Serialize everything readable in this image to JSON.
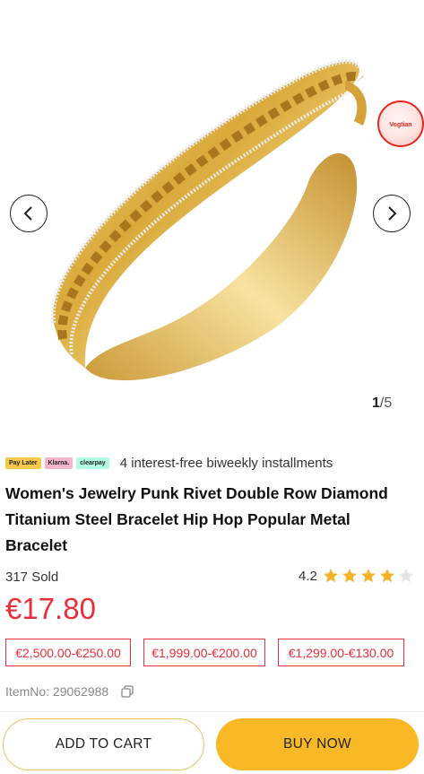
{
  "gallery": {
    "image_alt": "Gold bracelet with rivets and diamond rows",
    "current_index": "1",
    "total": "/5",
    "prev_icon": "chevron-left-icon",
    "next_icon": "chevron-right-icon",
    "promo_badge_text": "Vogtian"
  },
  "payment": {
    "logos": [
      "Pay Later",
      "Klarna.",
      "clearpay"
    ],
    "installments_text": "4 interest-free biweekly installments"
  },
  "product": {
    "title": "Women's Jewelry Punk Rivet Double Row Diamond Titanium Steel Bracelet Hip Hop Popular Metal Bracelet",
    "sold": "317 Sold",
    "rating": "4.2",
    "rating_value": 4.2,
    "rating_max": 5,
    "price": "€17.80",
    "item_no": "ItemNo: 29062988"
  },
  "coupons": [
    "€2,500.00-€250.00",
    "€1,999.00-€200.00",
    "€1,299.00-€130.00"
  ],
  "actions": {
    "add_to_cart": "ADD TO CART",
    "buy_now": "BUY NOW"
  },
  "colors": {
    "price_red": "#e6303a",
    "buy_button": "#f9b826",
    "star": "#f5b32a",
    "star_empty": "#e5e5e5"
  }
}
